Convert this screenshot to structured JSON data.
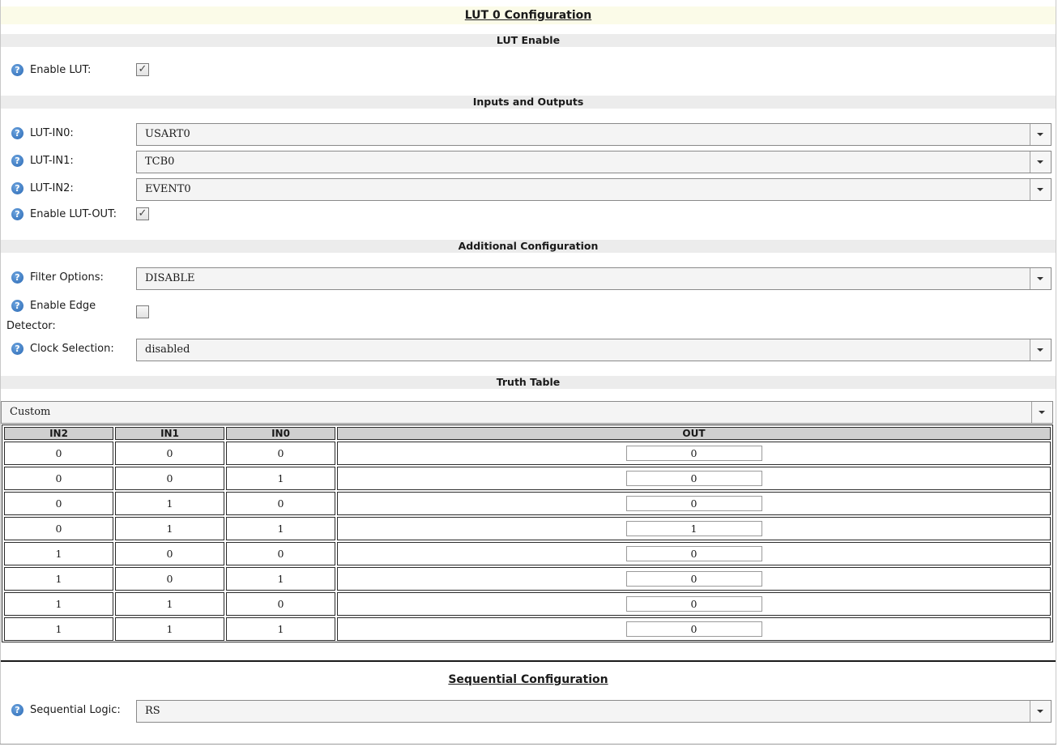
{
  "title": "LUT 0 Configuration",
  "sections": {
    "lut_enable": "LUT Enable",
    "inputs_outputs": "Inputs and Outputs",
    "additional": "Additional Configuration",
    "truth_table": "Truth Table"
  },
  "fields": {
    "enable_lut": {
      "label": "Enable LUT:",
      "checked": true
    },
    "lut_in0": {
      "label": "LUT-IN0:",
      "value": "USART0"
    },
    "lut_in1": {
      "label": "LUT-IN1:",
      "value": "TCB0"
    },
    "lut_in2": {
      "label": "LUT-IN2:",
      "value": "EVENT0"
    },
    "enable_lut_out": {
      "label": "Enable LUT-OUT:",
      "checked": true
    },
    "filter_options": {
      "label": "Filter Options:",
      "value": "DISABLE"
    },
    "enable_edge_detector": {
      "label_line1": "Enable Edge",
      "label_line2": "Detector:",
      "checked": false
    },
    "clock_selection": {
      "label": "Clock Selection:",
      "value": "disabled"
    }
  },
  "truth_table": {
    "preset": "Custom",
    "headers": [
      "IN2",
      "IN1",
      "IN0",
      "OUT"
    ],
    "rows": [
      [
        "0",
        "0",
        "0",
        "0"
      ],
      [
        "0",
        "0",
        "1",
        "0"
      ],
      [
        "0",
        "1",
        "0",
        "0"
      ],
      [
        "0",
        "1",
        "1",
        "1"
      ],
      [
        "1",
        "0",
        "0",
        "0"
      ],
      [
        "1",
        "0",
        "1",
        "0"
      ],
      [
        "1",
        "1",
        "0",
        "0"
      ],
      [
        "1",
        "1",
        "1",
        "0"
      ]
    ]
  },
  "sequential": {
    "title": "Sequential Configuration",
    "label": "Sequential Logic:",
    "value": "RS"
  },
  "icons": {
    "help": "?",
    "check": "✓"
  }
}
